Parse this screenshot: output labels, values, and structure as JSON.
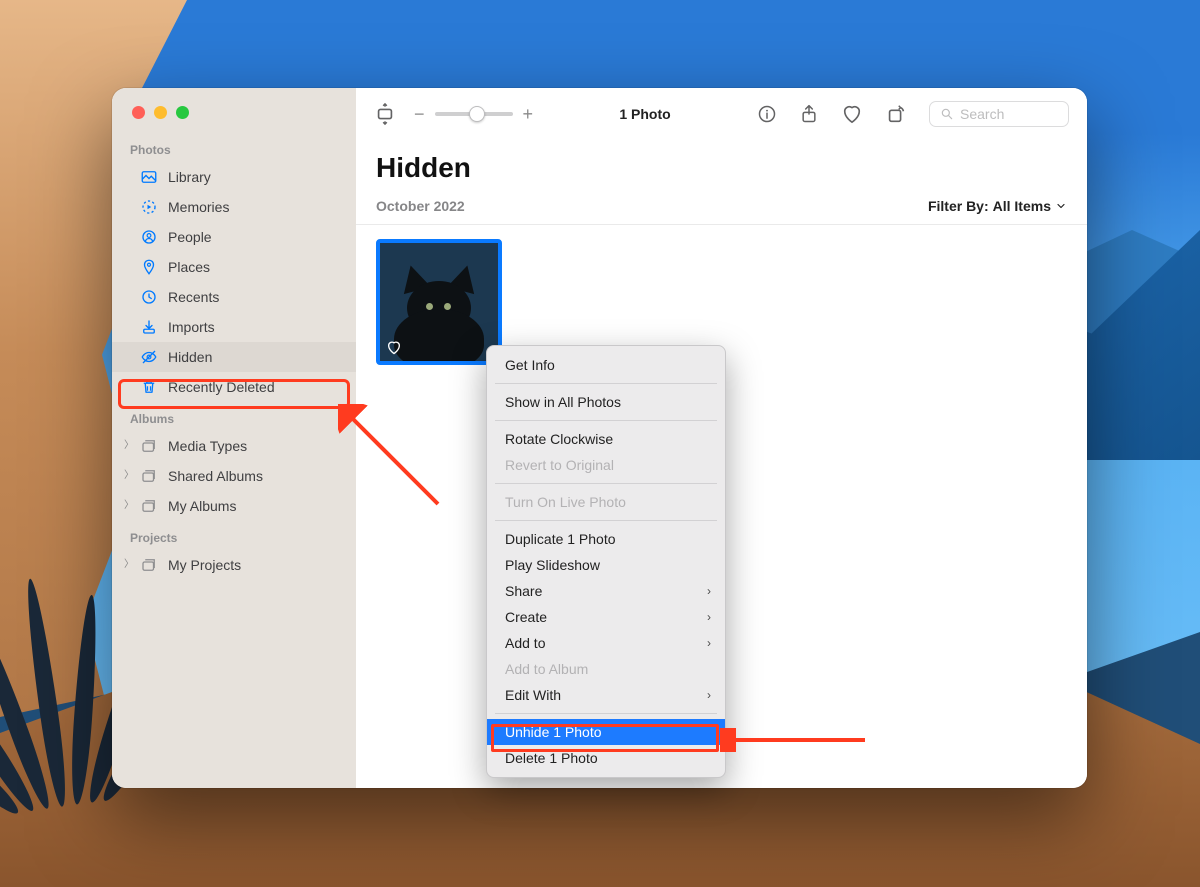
{
  "sidebar": {
    "sections": [
      {
        "heading": "Photos",
        "items": [
          {
            "label": "Library",
            "icon": "library"
          },
          {
            "label": "Memories",
            "icon": "memories"
          },
          {
            "label": "People",
            "icon": "people"
          },
          {
            "label": "Places",
            "icon": "places"
          },
          {
            "label": "Recents",
            "icon": "recents"
          },
          {
            "label": "Imports",
            "icon": "imports"
          },
          {
            "label": "Hidden",
            "icon": "hidden"
          },
          {
            "label": "Recently Deleted",
            "icon": "trash"
          }
        ]
      },
      {
        "heading": "Albums",
        "items": [
          {
            "label": "Media Types",
            "icon": "stack",
            "disc": true
          },
          {
            "label": "Shared Albums",
            "icon": "stack",
            "disc": true
          },
          {
            "label": "My Albums",
            "icon": "stack",
            "disc": true
          }
        ]
      },
      {
        "heading": "Projects",
        "items": [
          {
            "label": "My Projects",
            "icon": "stack",
            "disc": true
          }
        ]
      }
    ]
  },
  "toolbar": {
    "title": "1 Photo",
    "zoom": {
      "minus": "−",
      "plus": "+"
    },
    "search_placeholder": "Search"
  },
  "header": {
    "title": "Hidden",
    "date": "October 2022",
    "filter_prefix": "Filter By:",
    "filter_value": "All Items"
  },
  "context_menu": {
    "items": [
      {
        "label": "Get Info",
        "submenu": false,
        "disabled": false
      },
      {
        "sep": true
      },
      {
        "label": "Show in All Photos",
        "submenu": false,
        "disabled": false
      },
      {
        "sep": true
      },
      {
        "label": "Rotate Clockwise",
        "submenu": false,
        "disabled": false
      },
      {
        "label": "Revert to Original",
        "submenu": false,
        "disabled": true
      },
      {
        "sep": true
      },
      {
        "label": "Turn On Live Photo",
        "submenu": false,
        "disabled": true
      },
      {
        "sep": true
      },
      {
        "label": "Duplicate 1 Photo",
        "submenu": false,
        "disabled": false
      },
      {
        "label": "Play Slideshow",
        "submenu": false,
        "disabled": false
      },
      {
        "label": "Share",
        "submenu": true,
        "disabled": false
      },
      {
        "label": "Create",
        "submenu": true,
        "disabled": false
      },
      {
        "label": "Add to",
        "submenu": true,
        "disabled": false
      },
      {
        "label": "Add to Album",
        "submenu": false,
        "disabled": true
      },
      {
        "label": "Edit With",
        "submenu": true,
        "disabled": false
      },
      {
        "sep": true
      },
      {
        "label": "Unhide 1 Photo",
        "submenu": false,
        "disabled": false,
        "selected": true
      },
      {
        "label": "Delete 1 Photo",
        "submenu": false,
        "disabled": false
      }
    ]
  }
}
